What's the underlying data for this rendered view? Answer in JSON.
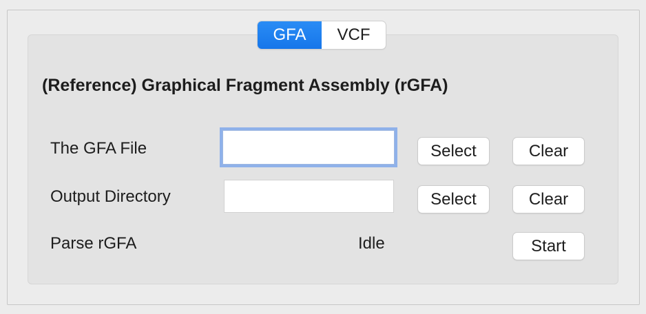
{
  "tabs": [
    {
      "label": "GFA",
      "selected": true
    },
    {
      "label": "VCF",
      "selected": false
    }
  ],
  "panel": {
    "title": "(Reference) Graphical Fragment Assembly (rGFA)"
  },
  "rows": {
    "gfa_file": {
      "label": "The GFA File",
      "value": "",
      "select_label": "Select",
      "clear_label": "Clear"
    },
    "output_dir": {
      "label": "Output Directory",
      "value": "",
      "select_label": "Select",
      "clear_label": "Clear"
    },
    "parse": {
      "label": "Parse rGFA",
      "status": "Idle",
      "start_label": "Start"
    }
  },
  "colors": {
    "accent": "#1a7ff0",
    "focus_ring": "#8fb1ea",
    "background": "#ececec",
    "panel": "#e3e3e3"
  }
}
